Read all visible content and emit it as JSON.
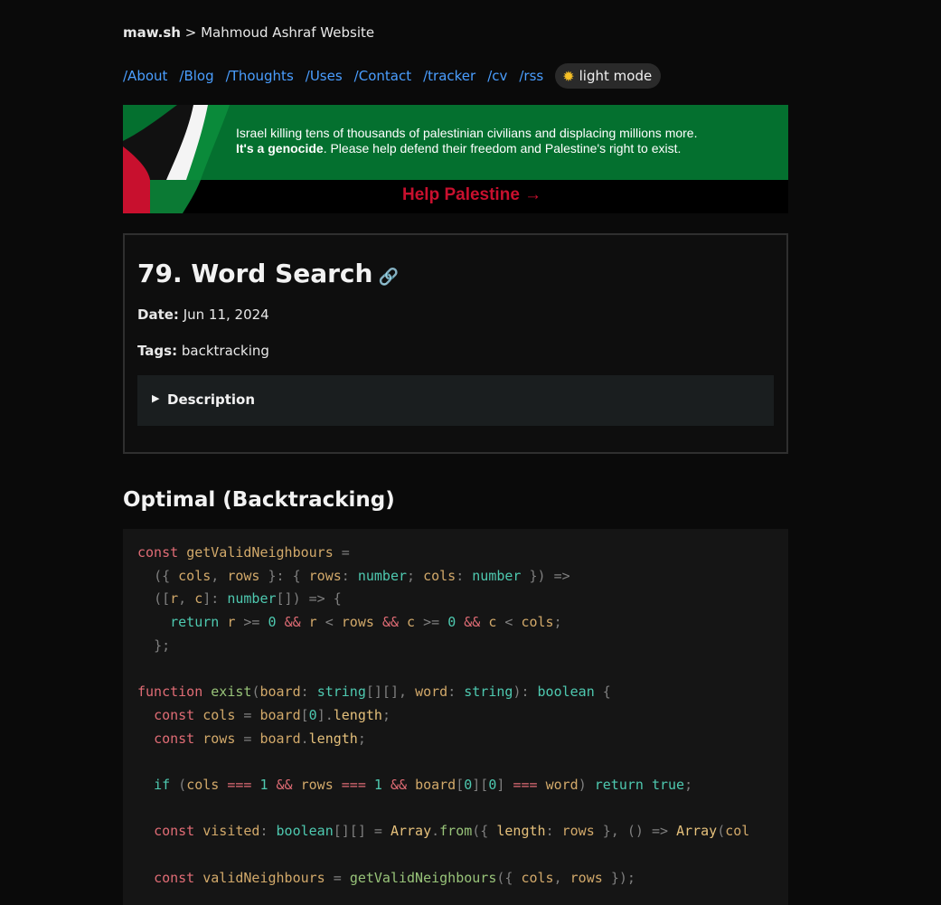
{
  "header": {
    "brand": "maw.sh",
    "separator": " > ",
    "site_name": "Mahmoud Ashraf Website"
  },
  "nav": {
    "items": [
      "/About",
      "/Blog",
      "/Thoughts",
      "/Uses",
      "/Contact",
      "/tracker",
      "/cv",
      "/rss"
    ],
    "mode_icon": "sun-icon",
    "mode_label": "light mode"
  },
  "banner": {
    "line1": "Israel killing tens of thousands of palestinian civilians and displacing millions more.",
    "line2_bold": "It's a genocide",
    "line2_rest": ". Please help defend their freedom and Palestine's right to exist.",
    "cta": "Help Palestine",
    "cta_arrow": "→",
    "colors": {
      "green": "#04702f",
      "red": "#c8102e"
    }
  },
  "post": {
    "title": "79. Word Search",
    "link_icon": "link-icon",
    "date_label": "Date:",
    "date": "Jun 11, 2024",
    "tags_label": "Tags:",
    "tags": "backtracking",
    "description_label": "Description"
  },
  "section": {
    "heading": "Optimal (Backtracking)"
  },
  "code": {
    "language": "typescript",
    "lines": [
      "const getValidNeighbours =",
      "  ({ cols, rows }: { rows: number; cols: number }) =>",
      "  ([r, c]: number[]) => {",
      "    return r >= 0 && r < rows && c >= 0 && c < cols;",
      "  };",
      "",
      "function exist(board: string[][], word: string): boolean {",
      "  const cols = board[0].length;",
      "  const rows = board.length;",
      "",
      "  if (cols === 1 && rows === 1 && board[0][0] === word) return true;",
      "",
      "  const visited: boolean[][] = Array.from({ length: rows }, () => Array(col",
      "",
      "  const validNeighbours = getValidNeighbours({ cols, rows });"
    ]
  },
  "theme": {
    "background": "#0a0a0a",
    "link": "#4a9eff",
    "code_bg": "#151515",
    "card_border": "#2f2f2f"
  }
}
